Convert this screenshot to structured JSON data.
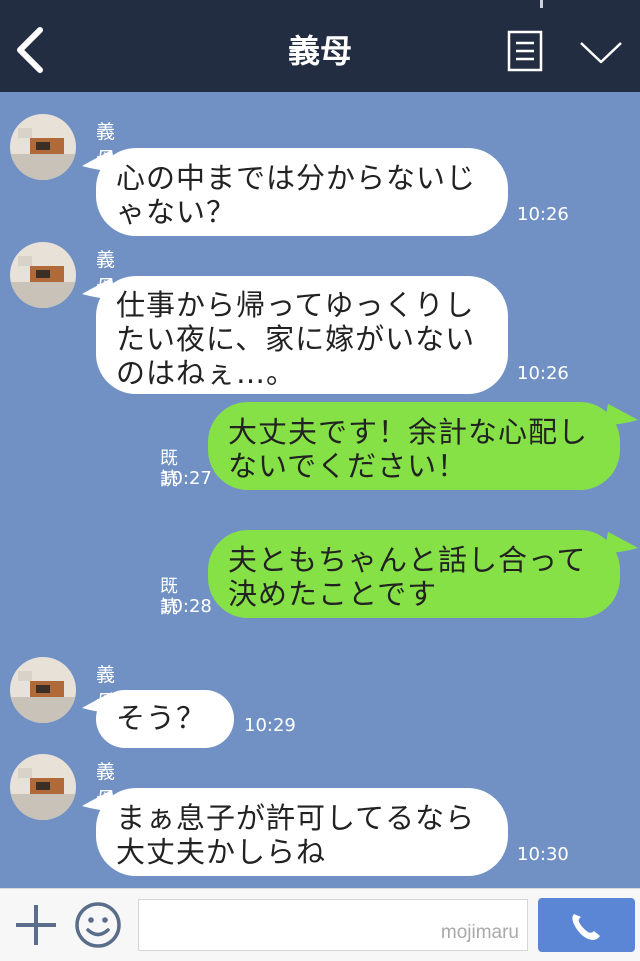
{
  "header": {
    "title": "義母",
    "back_icon": "chevron-left-icon",
    "menu_icon": "menu-icon",
    "expand_icon": "chevron-down-icon"
  },
  "messages": [
    {
      "from": "in",
      "sender": "義母",
      "text": "心の中までは分からないじ\nゃない？",
      "time": "10:26"
    },
    {
      "from": "in",
      "sender": "義母",
      "text": "仕事から帰ってゆっくりし\nたい夜に、家に嫁がいない\nのはねぇ…。",
      "time": "10:26"
    },
    {
      "from": "out",
      "read": "既読",
      "text": "大丈夫です！余計な心配し\nないでください！",
      "time": "10:27"
    },
    {
      "from": "out",
      "read": "既読",
      "text": "夫ともちゃんと話し合って\n決めたことです",
      "time": "10:28"
    },
    {
      "from": "in",
      "sender": "義母",
      "text": "そう？",
      "time": "10:29"
    },
    {
      "from": "in",
      "sender": "義母",
      "text": "まぁ息子が許可してるなら\n大丈夫かしらね",
      "time": "10:30"
    }
  ],
  "footer": {
    "watermark": "mojimaru",
    "plus_icon": "plus-icon",
    "emoji_icon": "smiley-icon",
    "call_icon": "phone-icon"
  },
  "colors": {
    "background": "#7191c5",
    "header": "#232d41",
    "incoming_bubble": "#ffffff",
    "outgoing_bubble": "#86e146",
    "call_button": "#5b86d6"
  }
}
